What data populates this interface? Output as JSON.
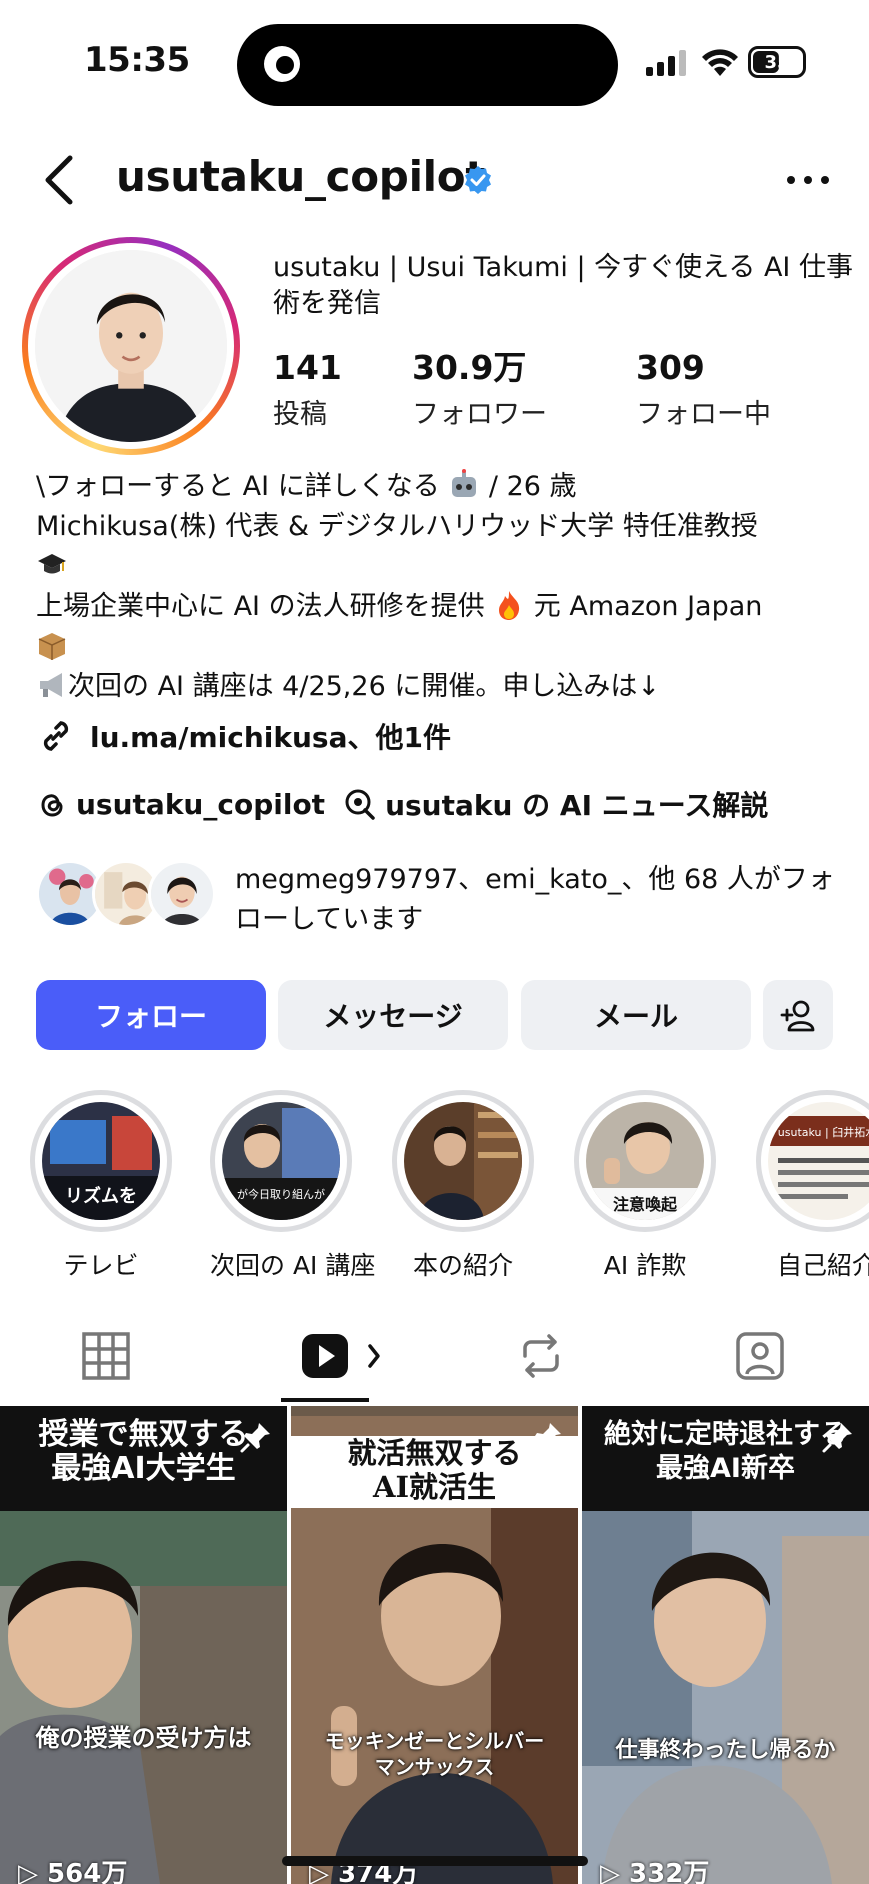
{
  "status_bar": {
    "time": "15:35",
    "battery": "35"
  },
  "header": {
    "username": "usutaku_copilot"
  },
  "profile": {
    "display_name": "usutaku | Usui Takumi | 今すぐ使える AI 仕事術を発信",
    "stats": [
      {
        "value": "141",
        "label": "投稿"
      },
      {
        "value": "30.9万",
        "label": "フォロワー"
      },
      {
        "value": "309",
        "label": "フォロー中"
      }
    ],
    "bio": {
      "line1": "\\フォローすると AI に詳しくなる",
      "line1b": "/ 26 歳",
      "line2": "Michikusa(株) 代表 & デジタルハリウッド大学 特任准教授",
      "line3": "上場企業中心に AI の法人研修を提供",
      "line3b": "元 Amazon Japan",
      "line4": "次回の AI 講座は 4/25,26 に開催。申し込みは↓"
    },
    "link": "lu.ma/michikusa、他1件",
    "threads_handle": "usutaku_copilot",
    "channel": "usutaku の AI ニュース解説",
    "followed_by": "megmeg979797、emi_kato_、他 68 人がフォローしています"
  },
  "buttons": {
    "follow": "フォロー",
    "message": "メッセージ",
    "email": "メール"
  },
  "highlights": [
    {
      "label": "テレビ"
    },
    {
      "label": "次回の AI 講座"
    },
    {
      "label": "本の紹介"
    },
    {
      "label": "AI 詐欺"
    },
    {
      "label": "自己紹介"
    }
  ],
  "highlight_overlay": {
    "tv": "リズムを",
    "next": "が今日取り組んが",
    "scam": "注意喚起",
    "intro": "usutaku | 臼井拓水"
  },
  "reels": [
    {
      "title_1": "授業で無双する",
      "title_2": "最強AI大学生",
      "caption": "俺の授業の受け方は",
      "views": "564万"
    },
    {
      "title_1": "就活無双する",
      "title_2": "AI就活生",
      "caption": "モッキンゼーとシルバーマンサックス",
      "views": "374万"
    },
    {
      "title_1": "絶対に定時退社する",
      "title_2": "最強AI新卒",
      "caption": "仕事終わったし帰るか",
      "views": "332万"
    }
  ],
  "colors": {
    "follow_button": "#4a5df9",
    "verified": "#3897f0",
    "button_bg": "#eef0f3"
  }
}
